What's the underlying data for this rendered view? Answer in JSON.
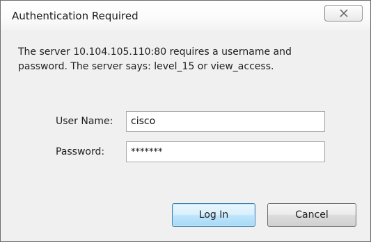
{
  "dialog": {
    "title": "Authentication Required",
    "close_icon": "close-icon",
    "message_line1": "The server 10.104.105.110:80 requires a username and",
    "message_line2": "password. The server says: level_15 or view_access."
  },
  "form": {
    "username_label": "User Name:",
    "username_value": "cisco",
    "password_label": "Password:",
    "password_value": "*******"
  },
  "buttons": {
    "login_label": "Log In",
    "cancel_label": "Cancel"
  },
  "colors": {
    "default_button_border": "#3c7fb1",
    "dialog_background": "#f0f0f0"
  }
}
